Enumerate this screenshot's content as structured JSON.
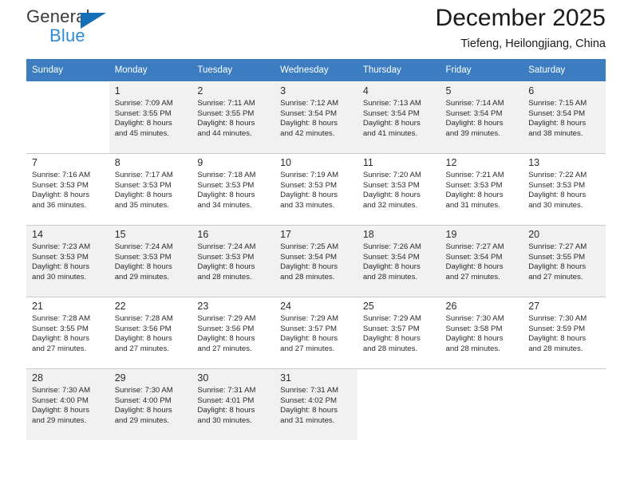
{
  "brand": {
    "name_top": "General",
    "name_bottom": "Blue",
    "accent_color": "#136fb7",
    "accent_color_light": "#2e8bd4"
  },
  "header": {
    "title": "December 2025",
    "location": "Tiefeng, Heilongjiang, China"
  },
  "calendar": {
    "header_bg": "#3b7dc0",
    "header_text_color": "#ffffff",
    "shaded_cell_bg": "#f1f1f1",
    "weekdays": [
      "Sunday",
      "Monday",
      "Tuesday",
      "Wednesday",
      "Thursday",
      "Friday",
      "Saturday"
    ],
    "weeks": [
      [
        {
          "empty": true
        },
        {
          "day": "1",
          "sunrise": "Sunrise: 7:09 AM",
          "sunset": "Sunset: 3:55 PM",
          "daylight1": "Daylight: 8 hours",
          "daylight2": "and 45 minutes."
        },
        {
          "day": "2",
          "sunrise": "Sunrise: 7:11 AM",
          "sunset": "Sunset: 3:55 PM",
          "daylight1": "Daylight: 8 hours",
          "daylight2": "and 44 minutes."
        },
        {
          "day": "3",
          "sunrise": "Sunrise: 7:12 AM",
          "sunset": "Sunset: 3:54 PM",
          "daylight1": "Daylight: 8 hours",
          "daylight2": "and 42 minutes."
        },
        {
          "day": "4",
          "sunrise": "Sunrise: 7:13 AM",
          "sunset": "Sunset: 3:54 PM",
          "daylight1": "Daylight: 8 hours",
          "daylight2": "and 41 minutes."
        },
        {
          "day": "5",
          "sunrise": "Sunrise: 7:14 AM",
          "sunset": "Sunset: 3:54 PM",
          "daylight1": "Daylight: 8 hours",
          "daylight2": "and 39 minutes."
        },
        {
          "day": "6",
          "sunrise": "Sunrise: 7:15 AM",
          "sunset": "Sunset: 3:54 PM",
          "daylight1": "Daylight: 8 hours",
          "daylight2": "and 38 minutes."
        }
      ],
      [
        {
          "day": "7",
          "sunrise": "Sunrise: 7:16 AM",
          "sunset": "Sunset: 3:53 PM",
          "daylight1": "Daylight: 8 hours",
          "daylight2": "and 36 minutes."
        },
        {
          "day": "8",
          "sunrise": "Sunrise: 7:17 AM",
          "sunset": "Sunset: 3:53 PM",
          "daylight1": "Daylight: 8 hours",
          "daylight2": "and 35 minutes."
        },
        {
          "day": "9",
          "sunrise": "Sunrise: 7:18 AM",
          "sunset": "Sunset: 3:53 PM",
          "daylight1": "Daylight: 8 hours",
          "daylight2": "and 34 minutes."
        },
        {
          "day": "10",
          "sunrise": "Sunrise: 7:19 AM",
          "sunset": "Sunset: 3:53 PM",
          "daylight1": "Daylight: 8 hours",
          "daylight2": "and 33 minutes."
        },
        {
          "day": "11",
          "sunrise": "Sunrise: 7:20 AM",
          "sunset": "Sunset: 3:53 PM",
          "daylight1": "Daylight: 8 hours",
          "daylight2": "and 32 minutes."
        },
        {
          "day": "12",
          "sunrise": "Sunrise: 7:21 AM",
          "sunset": "Sunset: 3:53 PM",
          "daylight1": "Daylight: 8 hours",
          "daylight2": "and 31 minutes."
        },
        {
          "day": "13",
          "sunrise": "Sunrise: 7:22 AM",
          "sunset": "Sunset: 3:53 PM",
          "daylight1": "Daylight: 8 hours",
          "daylight2": "and 30 minutes."
        }
      ],
      [
        {
          "day": "14",
          "sunrise": "Sunrise: 7:23 AM",
          "sunset": "Sunset: 3:53 PM",
          "daylight1": "Daylight: 8 hours",
          "daylight2": "and 30 minutes."
        },
        {
          "day": "15",
          "sunrise": "Sunrise: 7:24 AM",
          "sunset": "Sunset: 3:53 PM",
          "daylight1": "Daylight: 8 hours",
          "daylight2": "and 29 minutes."
        },
        {
          "day": "16",
          "sunrise": "Sunrise: 7:24 AM",
          "sunset": "Sunset: 3:53 PM",
          "daylight1": "Daylight: 8 hours",
          "daylight2": "and 28 minutes."
        },
        {
          "day": "17",
          "sunrise": "Sunrise: 7:25 AM",
          "sunset": "Sunset: 3:54 PM",
          "daylight1": "Daylight: 8 hours",
          "daylight2": "and 28 minutes."
        },
        {
          "day": "18",
          "sunrise": "Sunrise: 7:26 AM",
          "sunset": "Sunset: 3:54 PM",
          "daylight1": "Daylight: 8 hours",
          "daylight2": "and 28 minutes."
        },
        {
          "day": "19",
          "sunrise": "Sunrise: 7:27 AM",
          "sunset": "Sunset: 3:54 PM",
          "daylight1": "Daylight: 8 hours",
          "daylight2": "and 27 minutes."
        },
        {
          "day": "20",
          "sunrise": "Sunrise: 7:27 AM",
          "sunset": "Sunset: 3:55 PM",
          "daylight1": "Daylight: 8 hours",
          "daylight2": "and 27 minutes."
        }
      ],
      [
        {
          "day": "21",
          "sunrise": "Sunrise: 7:28 AM",
          "sunset": "Sunset: 3:55 PM",
          "daylight1": "Daylight: 8 hours",
          "daylight2": "and 27 minutes."
        },
        {
          "day": "22",
          "sunrise": "Sunrise: 7:28 AM",
          "sunset": "Sunset: 3:56 PM",
          "daylight1": "Daylight: 8 hours",
          "daylight2": "and 27 minutes."
        },
        {
          "day": "23",
          "sunrise": "Sunrise: 7:29 AM",
          "sunset": "Sunset: 3:56 PM",
          "daylight1": "Daylight: 8 hours",
          "daylight2": "and 27 minutes."
        },
        {
          "day": "24",
          "sunrise": "Sunrise: 7:29 AM",
          "sunset": "Sunset: 3:57 PM",
          "daylight1": "Daylight: 8 hours",
          "daylight2": "and 27 minutes."
        },
        {
          "day": "25",
          "sunrise": "Sunrise: 7:29 AM",
          "sunset": "Sunset: 3:57 PM",
          "daylight1": "Daylight: 8 hours",
          "daylight2": "and 28 minutes."
        },
        {
          "day": "26",
          "sunrise": "Sunrise: 7:30 AM",
          "sunset": "Sunset: 3:58 PM",
          "daylight1": "Daylight: 8 hours",
          "daylight2": "and 28 minutes."
        },
        {
          "day": "27",
          "sunrise": "Sunrise: 7:30 AM",
          "sunset": "Sunset: 3:59 PM",
          "daylight1": "Daylight: 8 hours",
          "daylight2": "and 28 minutes."
        }
      ],
      [
        {
          "day": "28",
          "sunrise": "Sunrise: 7:30 AM",
          "sunset": "Sunset: 4:00 PM",
          "daylight1": "Daylight: 8 hours",
          "daylight2": "and 29 minutes."
        },
        {
          "day": "29",
          "sunrise": "Sunrise: 7:30 AM",
          "sunset": "Sunset: 4:00 PM",
          "daylight1": "Daylight: 8 hours",
          "daylight2": "and 29 minutes."
        },
        {
          "day": "30",
          "sunrise": "Sunrise: 7:31 AM",
          "sunset": "Sunset: 4:01 PM",
          "daylight1": "Daylight: 8 hours",
          "daylight2": "and 30 minutes."
        },
        {
          "day": "31",
          "sunrise": "Sunrise: 7:31 AM",
          "sunset": "Sunset: 4:02 PM",
          "daylight1": "Daylight: 8 hours",
          "daylight2": "and 31 minutes."
        },
        {
          "empty": true
        },
        {
          "empty": true
        },
        {
          "empty": true
        }
      ]
    ]
  }
}
